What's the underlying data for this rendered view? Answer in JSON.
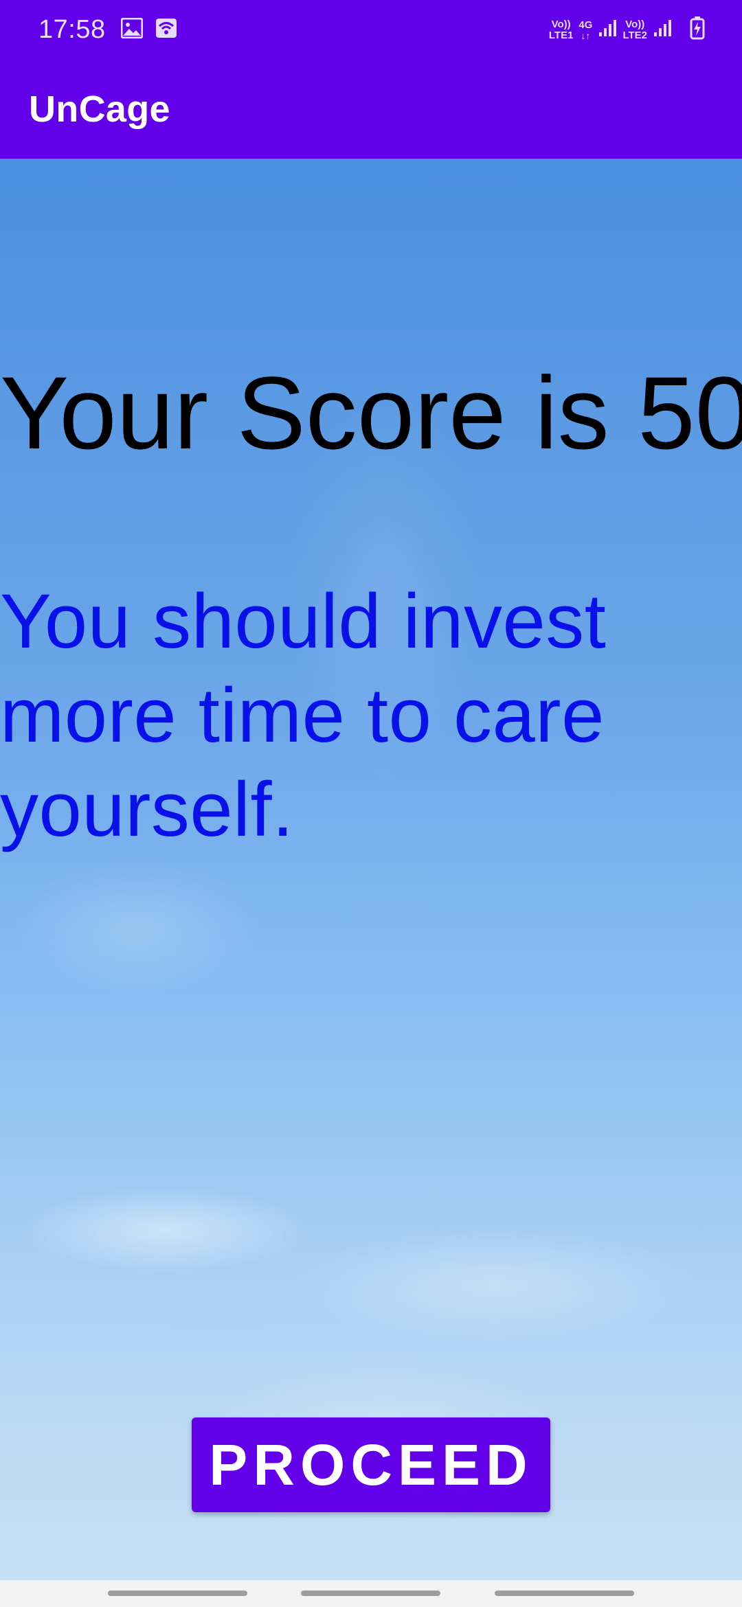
{
  "status_bar": {
    "time": "17:58",
    "sim1_top": "Vo))",
    "sim1_bottom": "LTE1",
    "network_top": "4G",
    "network_bottom": "↓↑",
    "sim2_top": "Vo))",
    "sim2_bottom": "LTE2",
    "icons": [
      "gallery-icon",
      "wifi-hotspot-icon",
      "signal-icon",
      "battery-charging-icon"
    ]
  },
  "app_bar": {
    "title": "UnCage"
  },
  "main": {
    "score_text": "Your Score is 50",
    "advice_text": "You should invest more time to care yourself.",
    "proceed_label": "PROCEED"
  },
  "colors": {
    "primary": "#6200ea",
    "advice_text": "#0a10e8",
    "score_text": "#000000"
  }
}
